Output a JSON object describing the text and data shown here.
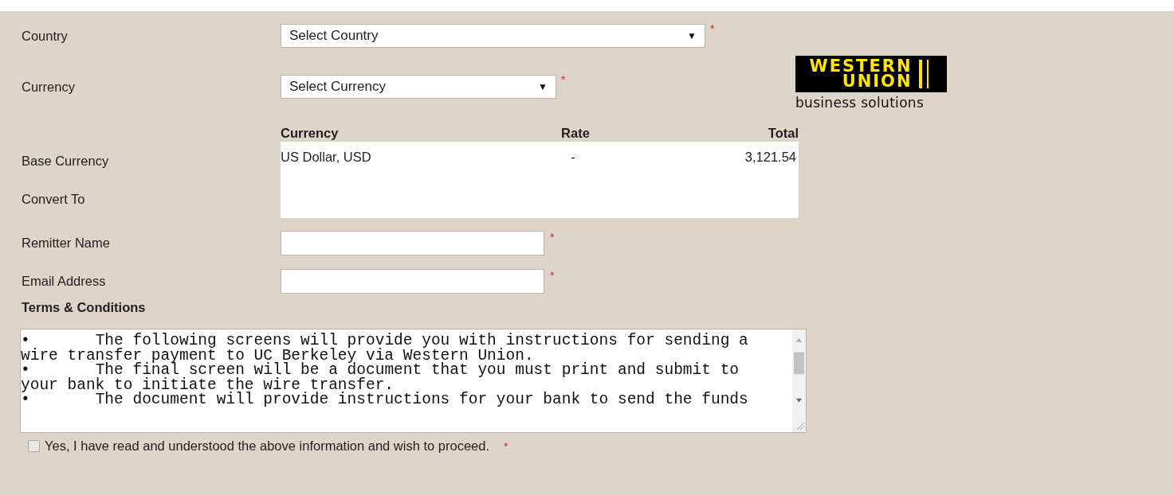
{
  "form": {
    "country": {
      "label": "Country",
      "value": "Select Country",
      "caret": "▼",
      "required_mark": "*"
    },
    "currency": {
      "label": "Currency",
      "value": "Select Currency",
      "caret": "▼",
      "required_mark": "*"
    },
    "logo": {
      "line1": "WESTERN",
      "line2": "UNION",
      "tagline": "business solutions"
    },
    "conversion": {
      "columns": [
        "Currency",
        "Rate",
        "Total"
      ],
      "row_labels": [
        "Base Currency",
        "Convert To"
      ],
      "rows": [
        {
          "currency": "US Dollar, USD",
          "rate": "-",
          "total": "3,121.54"
        }
      ]
    },
    "fields": [
      {
        "label": "Remitter Name",
        "required_mark": "*"
      },
      {
        "label": "Email Address",
        "required_mark": "*"
      }
    ],
    "terms": {
      "title": "Terms & Conditions",
      "paragraphs": [
        "•\tThe following screens will provide you with instructions for sending a wire transfer payment to UC Berkeley via Western Union.",
        "•\tThe final screen will be a document that you must print and submit to your bank to initiate the wire transfer.",
        "•\tThe document will provide instructions for your bank to send the funds"
      ]
    },
    "agree": {
      "label": "Yes, I have read and understood the above information and wish to proceed.",
      "checked": false,
      "required_mark": "*"
    }
  }
}
